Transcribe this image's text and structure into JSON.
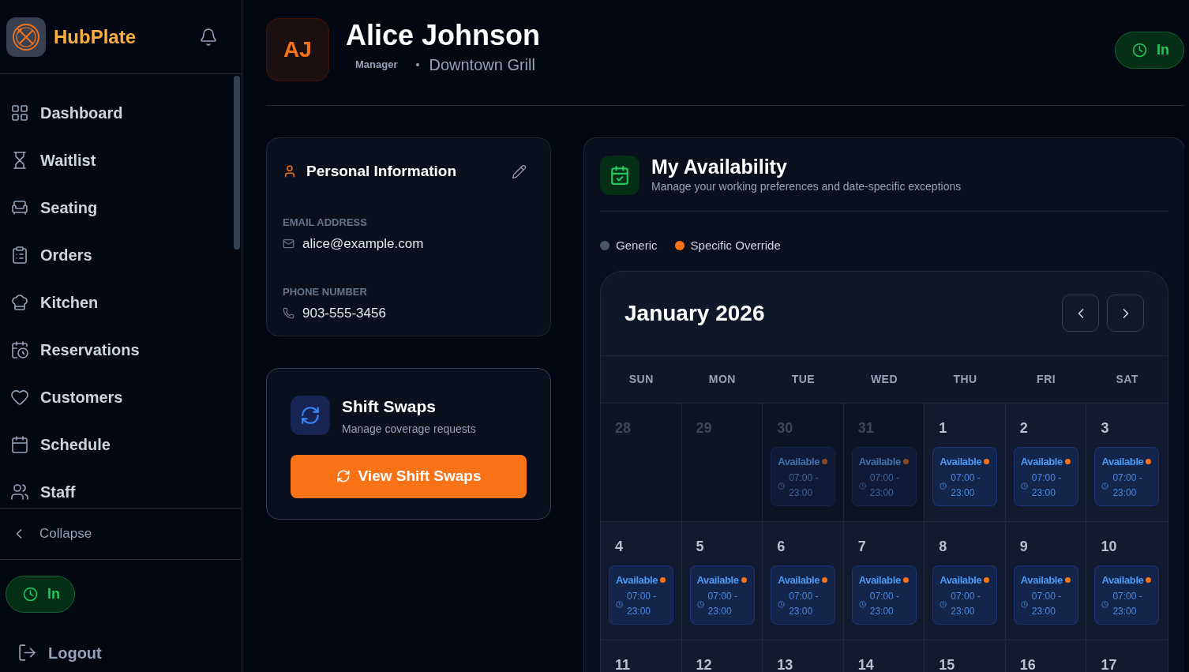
{
  "sidebar": {
    "brand": "HubPlate",
    "items": [
      {
        "label": "Dashboard",
        "kind": "dashboard"
      },
      {
        "label": "Waitlist",
        "kind": "waitlist"
      },
      {
        "label": "Seating",
        "kind": "seating"
      },
      {
        "label": "Orders",
        "kind": "orders"
      },
      {
        "label": "Kitchen",
        "kind": "kitchen"
      },
      {
        "label": "Reservations",
        "kind": "reservations"
      },
      {
        "label": "Customers",
        "kind": "customers"
      },
      {
        "label": "Schedule",
        "kind": "schedule"
      },
      {
        "label": "Staff",
        "kind": "staff"
      }
    ],
    "collapse": "Collapse",
    "clock_status": "In",
    "logout": "Logout"
  },
  "profile": {
    "initials": "AJ",
    "name": "Alice Johnson",
    "role": "Manager",
    "location": "Downtown Grill",
    "clock_status": "In"
  },
  "personal_info": {
    "title": "Personal Information",
    "email_label": "EMAIL ADDRESS",
    "email": "alice@example.com",
    "phone_label": "PHONE NUMBER",
    "phone": "903-555-3456"
  },
  "shift_swaps": {
    "title": "Shift Swaps",
    "subtitle": "Manage coverage requests",
    "button": "View Shift Swaps"
  },
  "availability": {
    "title": "My Availability",
    "subtitle": "Manage your working preferences and date-specific exceptions",
    "legend": [
      {
        "label": "Generic",
        "color": "#475569"
      },
      {
        "label": "Specific Override",
        "color": "#f97316"
      }
    ],
    "month": "January 2026",
    "weekdays": [
      "SUN",
      "MON",
      "TUE",
      "WED",
      "THU",
      "FRI",
      "SAT"
    ],
    "weeks": [
      [
        {
          "day": "28",
          "outside": true
        },
        {
          "day": "29",
          "outside": true
        },
        {
          "day": "30",
          "outside": true,
          "slot": {
            "status": "Available",
            "time": "07:00 - 23:00",
            "override": true
          }
        },
        {
          "day": "31",
          "outside": true,
          "slot": {
            "status": "Available",
            "time": "07:00 - 23:00",
            "override": true
          }
        },
        {
          "day": "1",
          "outside": false,
          "slot": {
            "status": "Available",
            "time": "07:00 - 23:00",
            "override": true
          }
        },
        {
          "day": "2",
          "outside": false,
          "slot": {
            "status": "Available",
            "time": "07:00 - 23:00",
            "override": true
          }
        },
        {
          "day": "3",
          "outside": false,
          "slot": {
            "status": "Available",
            "time": "07:00 - 23:00",
            "override": true
          }
        }
      ],
      [
        {
          "day": "4",
          "outside": false,
          "slot": {
            "status": "Available",
            "time": "07:00 - 23:00",
            "override": true
          }
        },
        {
          "day": "5",
          "outside": false,
          "slot": {
            "status": "Available",
            "time": "07:00 - 23:00",
            "override": true
          }
        },
        {
          "day": "6",
          "outside": false,
          "slot": {
            "status": "Available",
            "time": "07:00 - 23:00",
            "override": true
          }
        },
        {
          "day": "7",
          "outside": false,
          "slot": {
            "status": "Available",
            "time": "07:00 - 23:00",
            "override": true
          }
        },
        {
          "day": "8",
          "outside": false,
          "slot": {
            "status": "Available",
            "time": "07:00 - 23:00",
            "override": true
          }
        },
        {
          "day": "9",
          "outside": false,
          "slot": {
            "status": "Available",
            "time": "07:00 - 23:00",
            "override": true
          }
        },
        {
          "day": "10",
          "outside": false,
          "slot": {
            "status": "Available",
            "time": "07:00 - 23:00",
            "override": true
          }
        }
      ],
      [
        {
          "day": "11",
          "outside": false
        },
        {
          "day": "12",
          "outside": false
        },
        {
          "day": "13",
          "outside": false
        },
        {
          "day": "14",
          "outside": false
        },
        {
          "day": "15",
          "outside": false
        },
        {
          "day": "16",
          "outside": false
        },
        {
          "day": "17",
          "outside": false
        }
      ]
    ]
  }
}
